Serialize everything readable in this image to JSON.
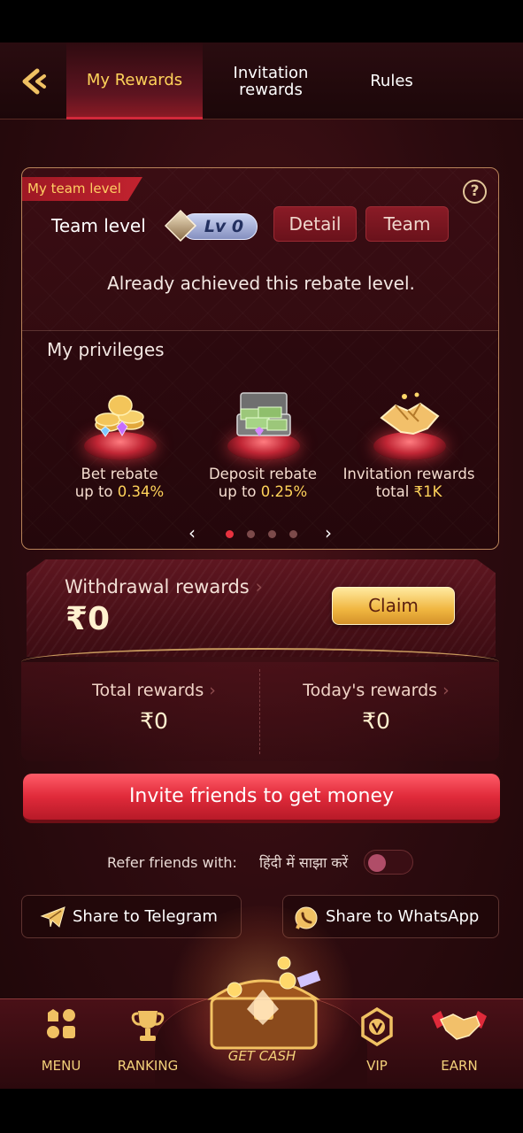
{
  "header": {
    "tabs": [
      {
        "label": "My Rewards",
        "active": true
      },
      {
        "label": "Invitation rewards",
        "active": false
      },
      {
        "label": "Rules",
        "active": false
      }
    ]
  },
  "team": {
    "tag": "My team level",
    "level_label": "Team level",
    "level_value": "Lv 0",
    "detail_label": "Detail",
    "team_label": "Team",
    "status": "Already achieved this rebate level."
  },
  "privileges": {
    "title": "My privileges",
    "items": [
      {
        "line1": "Bet rebate",
        "line2_prefix": "up to ",
        "line2_value": "0.34%",
        "icon": "coins-gems-icon"
      },
      {
        "line1": "Deposit rebate",
        "line2_prefix": "up to ",
        "line2_value": "0.25%",
        "icon": "money-case-icon"
      },
      {
        "line1": "Invitation rewards",
        "line2_prefix": "total ",
        "line2_value": "₹1K",
        "icon": "handshake-icon"
      }
    ],
    "pager": {
      "total": 4,
      "active": 0
    }
  },
  "withdrawal": {
    "title": "Withdrawal rewards",
    "amount": "₹0",
    "claim_label": "Claim"
  },
  "totals": {
    "total_label": "Total rewards",
    "total_value": "₹0",
    "today_label": "Today's rewards",
    "today_value": "₹0"
  },
  "invite_button": "Invite friends to get money",
  "refer": {
    "label": "Refer friends with:",
    "language": "हिंदी में साझा करें",
    "toggle_on": false
  },
  "share": {
    "telegram": "Share to Telegram",
    "whatsapp": "Share to WhatsApp"
  },
  "nav": {
    "menu": "MENU",
    "ranking": "RANKING",
    "get_cash": "GET CASH",
    "vip": "VIP",
    "earn": "EARN"
  },
  "colors": {
    "accent_gold": "#ffd35a",
    "accent_red": "#e02a3a",
    "background": "#2d0b0f"
  }
}
